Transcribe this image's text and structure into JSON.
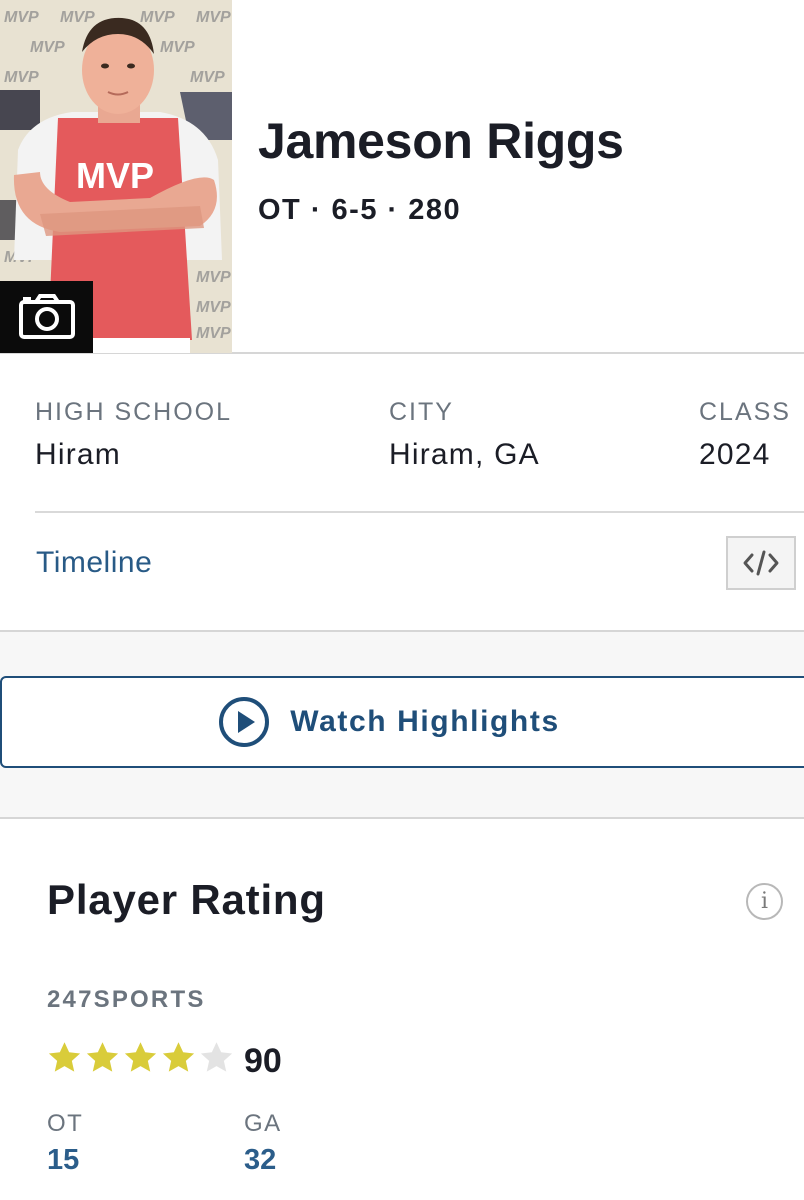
{
  "player": {
    "name": "Jameson Riggs",
    "meta": "OT · 6-5 · 280"
  },
  "photo": {
    "jersey_text": "MVP",
    "backdrop_text": "MVP"
  },
  "info": {
    "high_school_label": "HIGH SCHOOL",
    "high_school_value": "Hiram",
    "city_label": "CITY",
    "city_value": "Hiram, GA",
    "class_label": "CLASS",
    "class_value": "2024"
  },
  "links": {
    "timeline": "Timeline",
    "embed_icon": "code-embed-icon"
  },
  "highlights": {
    "label": "Watch Highlights",
    "icon": "play-circle-icon"
  },
  "rating": {
    "title": "Player Rating",
    "info_icon": "i",
    "source": "247SPORTS",
    "stars_filled": 4,
    "stars_total": 5,
    "score": "90",
    "ranks": [
      {
        "label": "OT",
        "value": "15"
      },
      {
        "label": "GA",
        "value": "32"
      }
    ]
  },
  "colors": {
    "accent": "#1f4e79",
    "link": "#285a86",
    "star_filled": "#d9cc3a",
    "star_empty": "#e3e3e3",
    "jersey": "#e45a5c"
  }
}
